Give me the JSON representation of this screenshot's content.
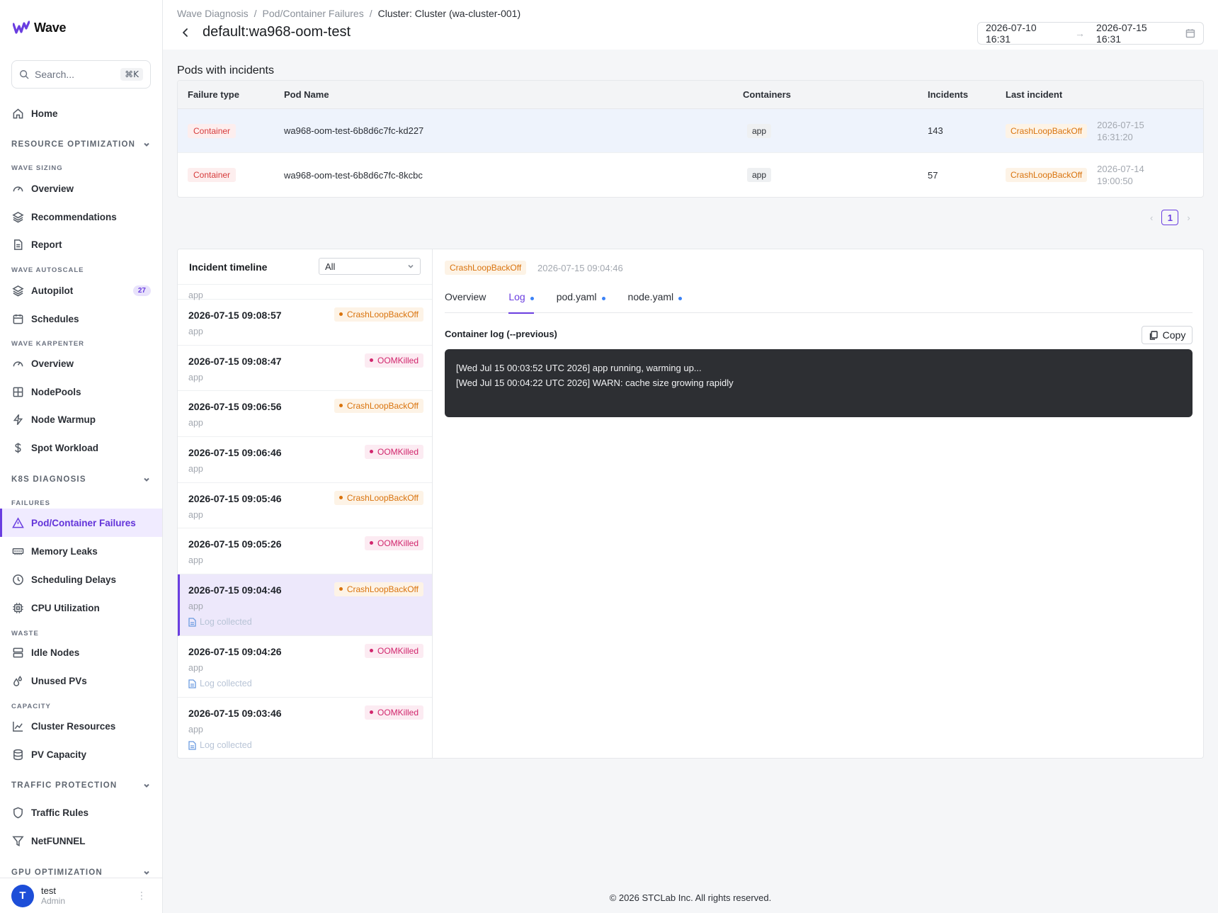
{
  "brand": {
    "name": "Wave"
  },
  "search": {
    "placeholder": "Search...",
    "shortcut": "⌘K"
  },
  "nav": {
    "home": "Home",
    "resource_optimization": "RESOURCE OPTIMIZATION",
    "wave_sizing": "WAVE SIZING",
    "overview": "Overview",
    "recommendations": "Recommendations",
    "report": "Report",
    "wave_autoscale": "WAVE AUTOSCALE",
    "autopilot": "Autopilot",
    "autopilot_count": "27",
    "schedules": "Schedules",
    "wave_karpenter": "WAVE KARPENTER",
    "overview2": "Overview",
    "nodepools": "NodePools",
    "node_warmup": "Node Warmup",
    "spot_workload": "Spot Workload",
    "k8s_diagnosis": "K8S DIAGNOSIS",
    "failures": "FAILURES",
    "pod_container_failures": "Pod/Container Failures",
    "memory_leaks": "Memory Leaks",
    "scheduling_delays": "Scheduling Delays",
    "cpu_utilization": "CPU Utilization",
    "waste": "WASTE",
    "idle_nodes": "Idle Nodes",
    "unused_pvs": "Unused PVs",
    "capacity": "CAPACITY",
    "cluster_resources": "Cluster Resources",
    "pv_capacity": "PV Capacity",
    "traffic_protection": "TRAFFIC PROTECTION",
    "traffic_rules": "Traffic Rules",
    "netfunnel": "NetFUNNEL",
    "gpu_optimization": "GPU OPTIMIZATION"
  },
  "user": {
    "initial": "T",
    "name": "test",
    "role": "Admin"
  },
  "header": {
    "crumbs": [
      "Wave Diagnosis",
      "/",
      "Pod/Container Failures",
      "/",
      "Cluster: Cluster (wa-cluster-001)"
    ],
    "title": "default:wa968-oom-test",
    "date_from": "2026-07-10 16:31",
    "date_arrow": "→",
    "date_to": "2026-07-15 16:31"
  },
  "pods": {
    "title": "Pods with incidents",
    "columns": [
      "Failure type",
      "Pod Name",
      "Containers",
      "Incidents",
      "Last incident"
    ],
    "rows": [
      {
        "failure_type": "Container",
        "pod_name": "wa968-oom-test-6b8d6c7fc-kd227",
        "container": "app",
        "incidents": "143",
        "last_reason": "CrashLoopBackOff",
        "last_date": "2026-07-15",
        "last_time": "16:31:20"
      },
      {
        "failure_type": "Container",
        "pod_name": "wa968-oom-test-6b8d6c7fc-8kcbc",
        "container": "app",
        "incidents": "57",
        "last_reason": "CrashLoopBackOff",
        "last_date": "2026-07-14",
        "last_time": "19:00:50"
      }
    ],
    "pager": {
      "prev": "‹",
      "page": "1",
      "next": "›"
    }
  },
  "timeline": {
    "title": "Incident timeline",
    "filter": "All",
    "partial_item": "app",
    "items": [
      {
        "time": "2026-07-15 09:08:57",
        "container": "app",
        "reason": "CrashLoopBackOff",
        "kind": "orange",
        "log": ""
      },
      {
        "time": "2026-07-15 09:08:47",
        "container": "app",
        "reason": "OOMKilled",
        "kind": "pink",
        "log": ""
      },
      {
        "time": "2026-07-15 09:06:56",
        "container": "app",
        "reason": "CrashLoopBackOff",
        "kind": "orange",
        "log": ""
      },
      {
        "time": "2026-07-15 09:06:46",
        "container": "app",
        "reason": "OOMKilled",
        "kind": "pink",
        "log": ""
      },
      {
        "time": "2026-07-15 09:05:46",
        "container": "app",
        "reason": "CrashLoopBackOff",
        "kind": "orange",
        "log": ""
      },
      {
        "time": "2026-07-15 09:05:26",
        "container": "app",
        "reason": "OOMKilled",
        "kind": "pink",
        "log": ""
      },
      {
        "time": "2026-07-15 09:04:46",
        "container": "app",
        "reason": "CrashLoopBackOff",
        "kind": "orange",
        "log": "Log collected"
      },
      {
        "time": "2026-07-15 09:04:26",
        "container": "app",
        "reason": "OOMKilled",
        "kind": "pink",
        "log": "Log collected"
      },
      {
        "time": "2026-07-15 09:03:46",
        "container": "app",
        "reason": "OOMKilled",
        "kind": "pink",
        "log": "Log collected"
      }
    ]
  },
  "detail": {
    "reason": "CrashLoopBackOff",
    "timestamp": "2026-07-15 09:04:46",
    "tabs": [
      "Overview",
      "Log",
      "pod.yaml",
      "node.yaml"
    ],
    "log_label": "Container log (--previous)",
    "copy_label": "Copy",
    "log_lines": [
      "[Wed Jul 15 00:03:52 UTC 2026] app running, warming up...",
      "[Wed Jul 15 00:04:22 UTC 2026] WARN: cache size growing rapidly"
    ]
  },
  "footer": {
    "text": "© 2026 STCLab Inc. All rights reserved."
  },
  "colors": {
    "accent": "#6a3ee0",
    "crash": "#d9730d",
    "oom": "#d1276d",
    "container_tag": "#d63b3b"
  }
}
